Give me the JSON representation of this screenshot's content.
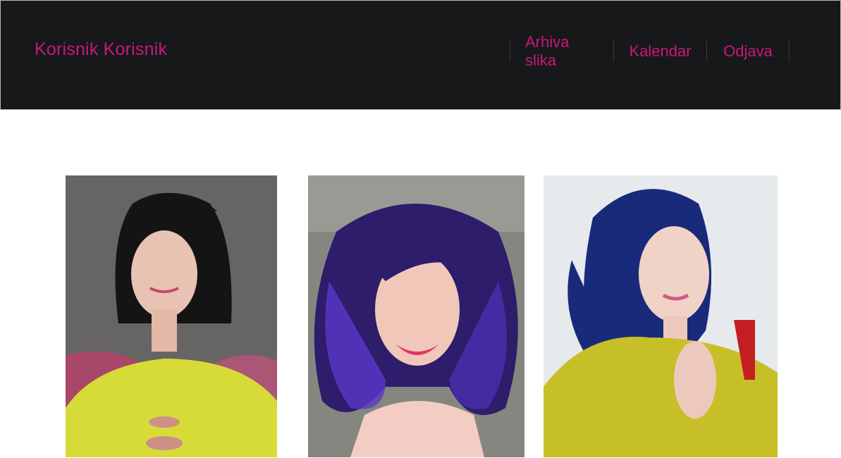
{
  "header": {
    "brand": "Korisnik Korisnik",
    "nav": [
      {
        "label": "Arhiva slika"
      },
      {
        "label": "Kalendar"
      },
      {
        "label": "Odjava"
      }
    ]
  },
  "colors": {
    "accent": "#c8187e",
    "header_bg": "#17181a",
    "page_bg": "#ffffff"
  },
  "gallery": {
    "photos": [
      {
        "name": "photo-black-bob-yellow-dress"
      },
      {
        "name": "photo-purple-curls-smile"
      },
      {
        "name": "photo-blue-hair-yellow-sweater"
      }
    ]
  }
}
